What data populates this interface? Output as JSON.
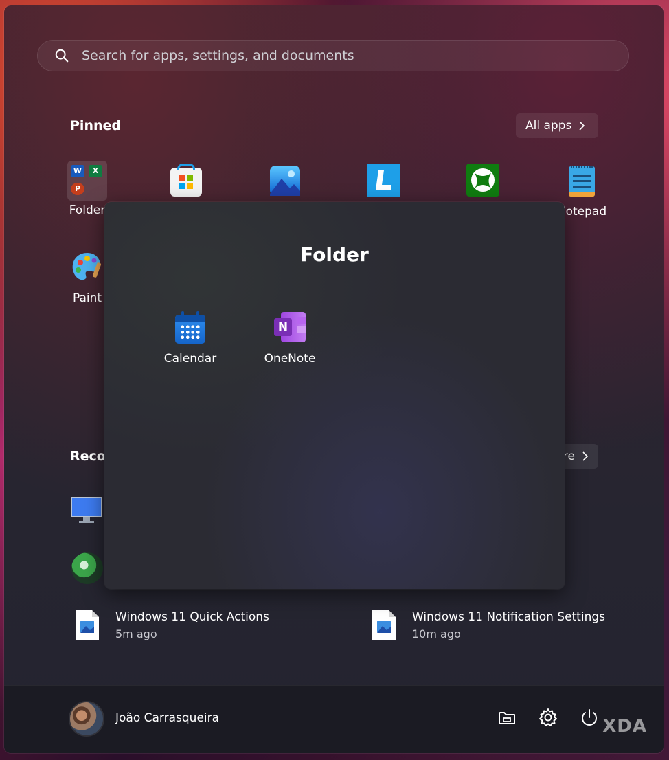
{
  "search": {
    "placeholder": "Search for apps, settings, and documents",
    "icon": "search-icon"
  },
  "pinned": {
    "title": "Pinned",
    "all_apps_label": "All apps",
    "apps": [
      {
        "label": "Folder",
        "icon": "folder-group-icon"
      },
      {
        "label": "",
        "icon": "microsoft-store-icon"
      },
      {
        "label": "",
        "icon": "photos-icon"
      },
      {
        "label": "",
        "icon": "letter-l-app-icon"
      },
      {
        "label": "",
        "icon": "xbox-icon"
      },
      {
        "label": "Notepad",
        "icon": "notepad-icon"
      },
      {
        "label": "Paint",
        "icon": "paint-icon"
      }
    ]
  },
  "folder": {
    "title": "Folder",
    "apps": [
      {
        "label": "Calendar",
        "icon": "calendar-icon"
      },
      {
        "label": "OneNote",
        "icon": "onenote-icon"
      }
    ]
  },
  "recommended": {
    "title": "Recommended",
    "more_label": "More",
    "items": [
      {
        "name": "Windows 11 Quick Actions",
        "time": "5m ago",
        "icon": "image-file-icon"
      },
      {
        "name": "Windows 11 Notification Settings",
        "time": "10m ago",
        "icon": "image-file-icon"
      }
    ]
  },
  "footer": {
    "user_name": "João Carrasqueira",
    "buttons": [
      "file-explorer-icon",
      "settings-gear-icon",
      "power-icon"
    ]
  },
  "watermark": "XDA",
  "colors": {
    "accent_blue": "#1e9fe8",
    "xbox_green": "#107c10",
    "onenote_purple": "#7a2fb5"
  }
}
